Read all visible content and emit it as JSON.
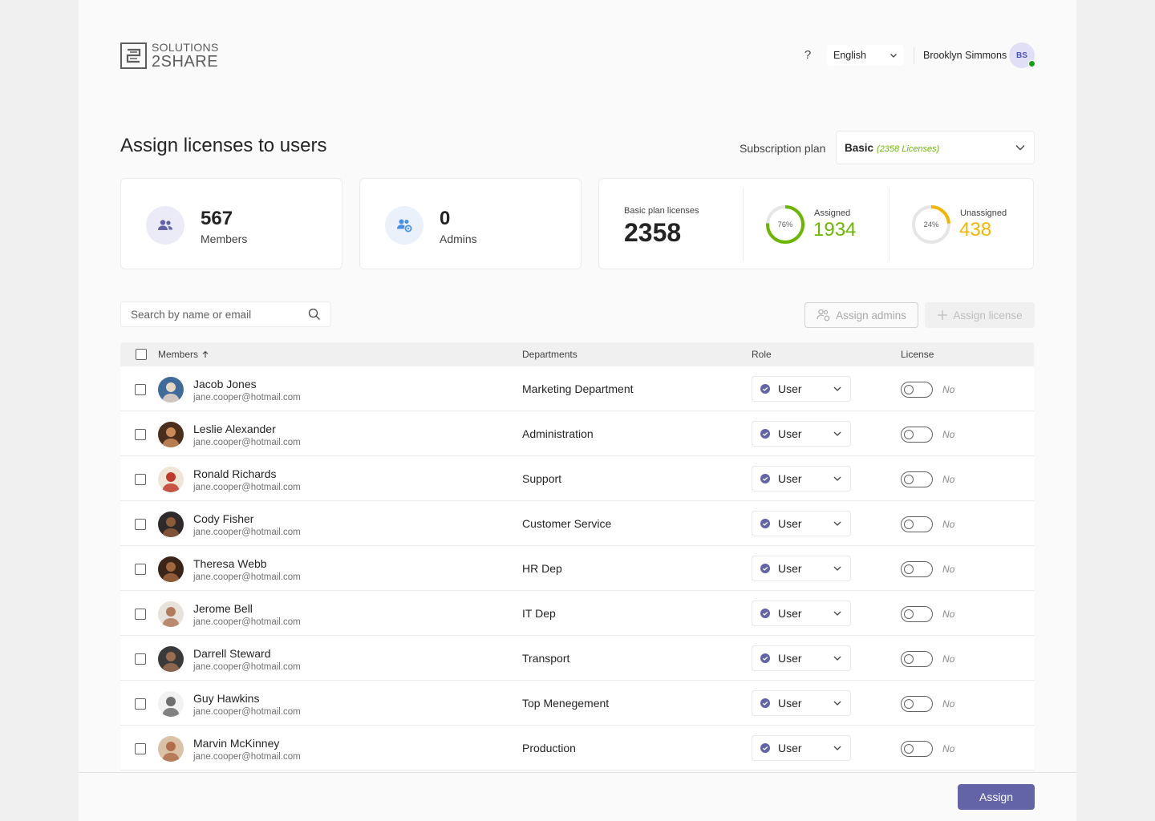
{
  "brand": {
    "line1": "SOLUTIONS",
    "line2": "2SHARE"
  },
  "header": {
    "help_label": "?",
    "language": "English",
    "user_name": "Brooklyn Simmons",
    "user_initials": "BS"
  },
  "page": {
    "title": "Assign licenses to users",
    "subscription_label": "Subscription plan",
    "plan_name": "Basic",
    "plan_note": "(2358 Licenses)"
  },
  "stats": {
    "members": {
      "value": "567",
      "label": "Members"
    },
    "admins": {
      "value": "0",
      "label": "Admins"
    },
    "licenses": {
      "plan_label": "Basic plan licenses",
      "plan_total": "2358",
      "assigned_label": "Assigned",
      "assigned_value": "1934",
      "assigned_pct_label": "76%",
      "assigned_fraction": 0.76,
      "unassigned_label": "Unassigned",
      "unassigned_value": "438",
      "unassigned_pct_label": "24%",
      "unassigned_fraction": 0.24
    }
  },
  "toolbar": {
    "search_placeholder": "Search by name or email",
    "assign_admins_label": "Assign admins",
    "assign_license_label": "Assign license"
  },
  "table": {
    "headers": {
      "members": "Members",
      "departments": "Departments",
      "role": "Role",
      "license": "License"
    },
    "rows": [
      {
        "name": "Jacob Jones",
        "email": "jane.cooper@hotmail.com",
        "department": "Marketing Department",
        "role": "User",
        "license": "No"
      },
      {
        "name": "Leslie Alexander",
        "email": "jane.cooper@hotmail.com",
        "department": "Administration",
        "role": "User",
        "license": "No"
      },
      {
        "name": "Ronald Richards",
        "email": "jane.cooper@hotmail.com",
        "department": "Support",
        "role": "User",
        "license": "No"
      },
      {
        "name": "Cody Fisher",
        "email": "jane.cooper@hotmail.com",
        "department": "Customer Service",
        "role": "User",
        "license": "No"
      },
      {
        "name": "Theresa Webb",
        "email": "jane.cooper@hotmail.com",
        "department": "HR Dep",
        "role": "User",
        "license": "No"
      },
      {
        "name": "Jerome Bell",
        "email": "jane.cooper@hotmail.com",
        "department": "IT Dep",
        "role": "User",
        "license": "No"
      },
      {
        "name": "Darrell Steward",
        "email": "jane.cooper@hotmail.com",
        "department": "Transport",
        "role": "User",
        "license": "No"
      },
      {
        "name": "Guy Hawkins",
        "email": "jane.cooper@hotmail.com",
        "department": "Top Menegement",
        "role": "User",
        "license": "No"
      },
      {
        "name": "Marvin McKinney",
        "email": "jane.cooper@hotmail.com",
        "department": "Production",
        "role": "User",
        "license": "No"
      }
    ]
  },
  "footer": {
    "assign_label": "Assign"
  },
  "colors": {
    "accent": "#6264a7",
    "assigned": "#6bb700",
    "unassigned": "#f2b600",
    "presence": "#13a10e"
  }
}
